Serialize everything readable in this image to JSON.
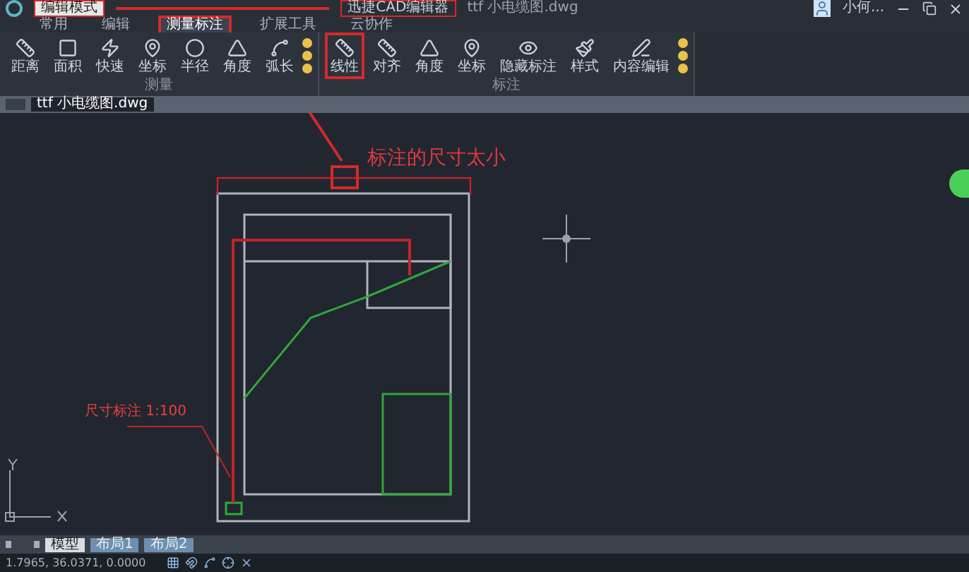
{
  "title_bar": {
    "quick_label": "编辑模式",
    "app_title": "迅捷CAD编辑器",
    "file_title": "ttf 小电缆图.dwg",
    "user": "小何..."
  },
  "tabs": [
    {
      "label": "常用",
      "selected": false,
      "highlighted": false
    },
    {
      "label": "编辑",
      "selected": false,
      "highlighted": false
    },
    {
      "label": "测量标注",
      "selected": true,
      "highlighted": true
    },
    {
      "label": "扩展工具",
      "selected": false,
      "highlighted": false
    },
    {
      "label": "云协作",
      "selected": false,
      "highlighted": false
    }
  ],
  "ribbon_groups": [
    {
      "label": "测量",
      "tools": [
        {
          "kind": "large",
          "label": "距离",
          "highlighted": false
        },
        {
          "kind": "large",
          "label": "面积",
          "highlighted": false
        },
        {
          "kind": "large",
          "label": "快速",
          "highlighted": false
        },
        {
          "kind": "large",
          "label": "坐标",
          "highlighted": false
        },
        {
          "kind": "large",
          "label": "半径",
          "highlighted": false
        },
        {
          "kind": "large",
          "label": "角度",
          "highlighted": false
        },
        {
          "kind": "large",
          "label": "弧长",
          "highlighted": false
        },
        {
          "kind": "small"
        }
      ]
    },
    {
      "label": "标注",
      "tools": [
        {
          "kind": "large",
          "label": "线性",
          "highlighted": true
        },
        {
          "kind": "large",
          "label": "对齐",
          "highlighted": false
        },
        {
          "kind": "large",
          "label": "角度",
          "highlighted": false
        },
        {
          "kind": "large",
          "label": "坐标",
          "highlighted": false
        },
        {
          "kind": "large",
          "label": "隐藏标注",
          "highlighted": false
        },
        {
          "kind": "large",
          "label": "样式",
          "highlighted": false
        },
        {
          "kind": "large",
          "label": "内容编辑",
          "highlighted": false
        },
        {
          "kind": "small"
        }
      ]
    }
  ],
  "document_tabs": [
    {
      "label": "ttf 小电缆图.dwg",
      "selected": true
    }
  ],
  "canvas": {
    "callout": "标注的尺寸太小",
    "leader_label": "尺寸标注 1:100"
  },
  "layout_tabs": [
    {
      "label": "模型",
      "selected": true
    },
    {
      "label": "布局1",
      "selected": false
    },
    {
      "label": "布局2",
      "selected": false
    }
  ],
  "status_bar": {
    "coordinates": "1.7965, 36.0371, 0.0000"
  }
}
